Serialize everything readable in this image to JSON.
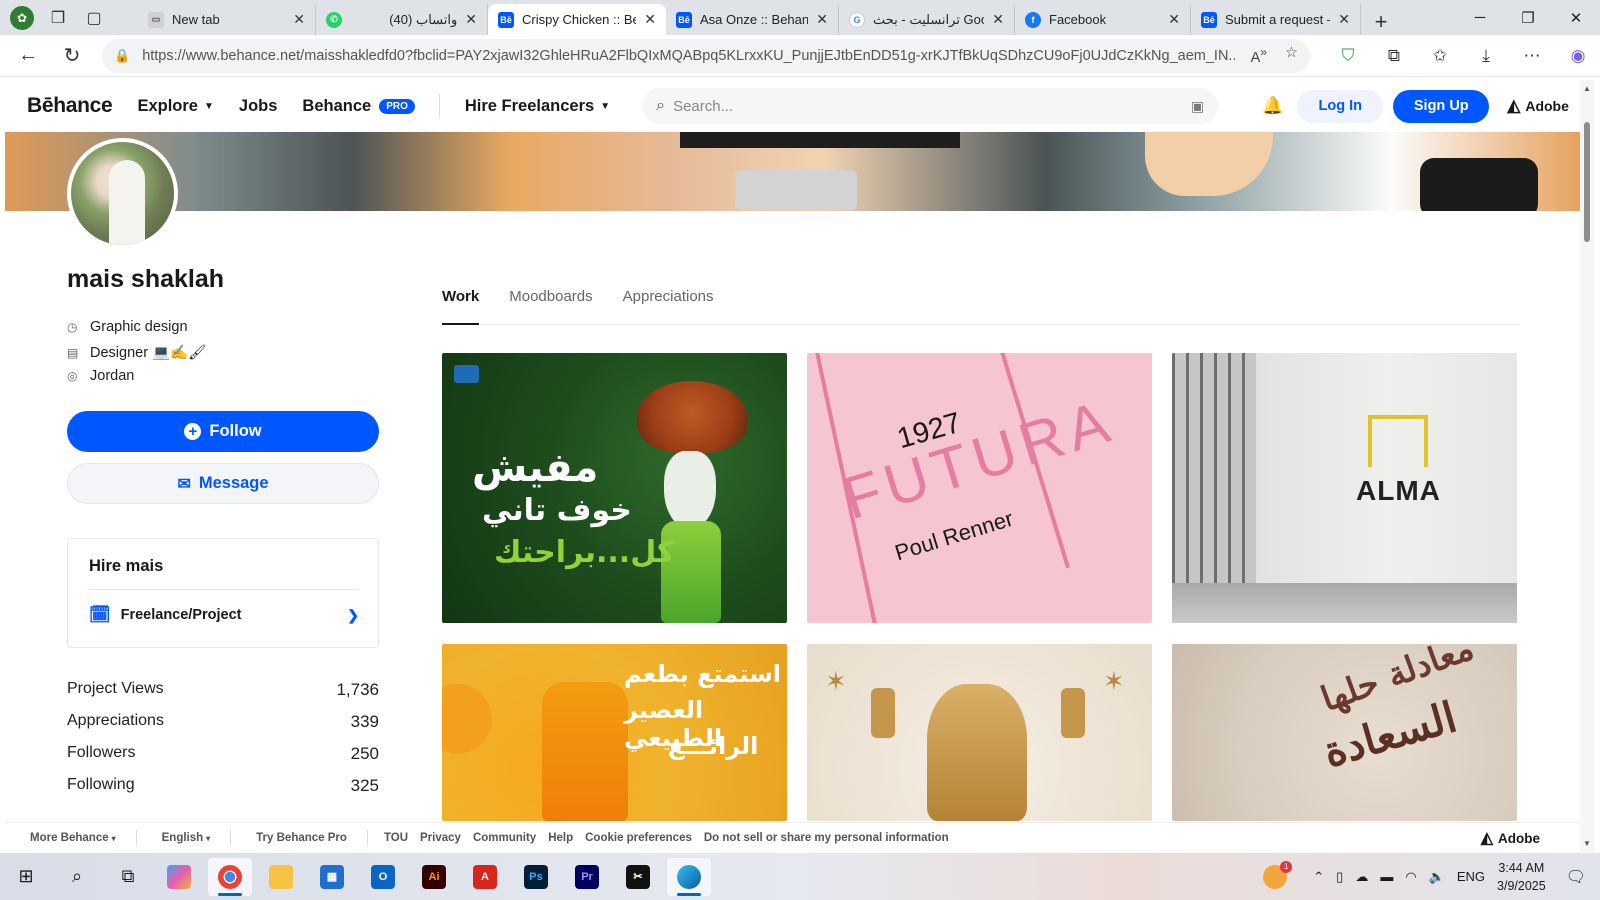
{
  "browser": {
    "tabs": [
      {
        "title": "New tab",
        "favicon": "page-icon",
        "color": "#6b6b6b"
      },
      {
        "title": "(40) واتساب",
        "favicon": "whatsapp-icon",
        "color": "#25d366"
      },
      {
        "title": "Crispy Chicken :: Beh",
        "favicon": "behance-icon",
        "color": "#0057ff",
        "active": true
      },
      {
        "title": "Asa Onze :: Behance",
        "favicon": "behance-icon",
        "color": "#0057ff"
      },
      {
        "title": "ترانسليت - بحث Google",
        "favicon": "google-icon",
        "color": "#4285f4"
      },
      {
        "title": "Facebook",
        "favicon": "facebook-icon",
        "color": "#1877f2"
      },
      {
        "title": "Submit a request – I",
        "favicon": "behance-icon",
        "color": "#0057ff"
      }
    ],
    "url": "https://www.behance.net/maisshakledfd0?fbclid=PAY2xjawI32GhleHRuA2FlbQIxMQABpq5KLrxxKU_PunjjEJtbEnDD51g-xrKJTfBkUqSDhzCU9oFj0UJdCzKkNg_aem_IN..."
  },
  "behance": {
    "logo": "Bēhance",
    "nav": {
      "explore": "Explore",
      "jobs": "Jobs",
      "behance": "Behance",
      "pro_badge": "PRO",
      "hire": "Hire Freelancers"
    },
    "search_placeholder": "Search...",
    "login": "Log In",
    "signup": "Sign Up",
    "adobe": "Adobe"
  },
  "profile": {
    "name": "mais shaklah",
    "field": "Graphic design",
    "role": "Designer 💻✍🖌",
    "location": "Jordan",
    "follow": "Follow",
    "message": "Message",
    "hire_title": "Hire mais",
    "hire_option": "Freelance/Project",
    "stats": [
      {
        "label": "Project Views",
        "value": "1,736"
      },
      {
        "label": "Appreciations",
        "value": "339"
      },
      {
        "label": "Followers",
        "value": "250"
      },
      {
        "label": "Following",
        "value": "325"
      }
    ]
  },
  "content": {
    "tabs": [
      "Work",
      "Moodboards",
      "Appreciations"
    ],
    "cards": {
      "c1": {
        "line1": "مفيش",
        "line2": "خوف تاني",
        "line3": "كل...براحتك"
      },
      "c2": {
        "year": "1927",
        "title": "FUTURA",
        "author": "Poul Renner"
      },
      "c3": {
        "brand": "ALMA"
      },
      "c4": {
        "line1": "استمتع بطعم",
        "line2": "العصير الطبيعي",
        "line3": "الرائـــع"
      },
      "c6": {
        "line1": "معادلة حلها",
        "line2": "السعادة"
      }
    }
  },
  "footer": {
    "more": "More Behance",
    "lang": "English",
    "pro": "Try Behance Pro",
    "links": [
      "TOU",
      "Privacy",
      "Community",
      "Help",
      "Cookie preferences",
      "Do not sell or share my personal information"
    ],
    "adobe": "Adobe"
  },
  "taskbar": {
    "lang": "ENG",
    "time": "3:44 AM",
    "date": "3/9/2025",
    "weather_badge": "1"
  }
}
